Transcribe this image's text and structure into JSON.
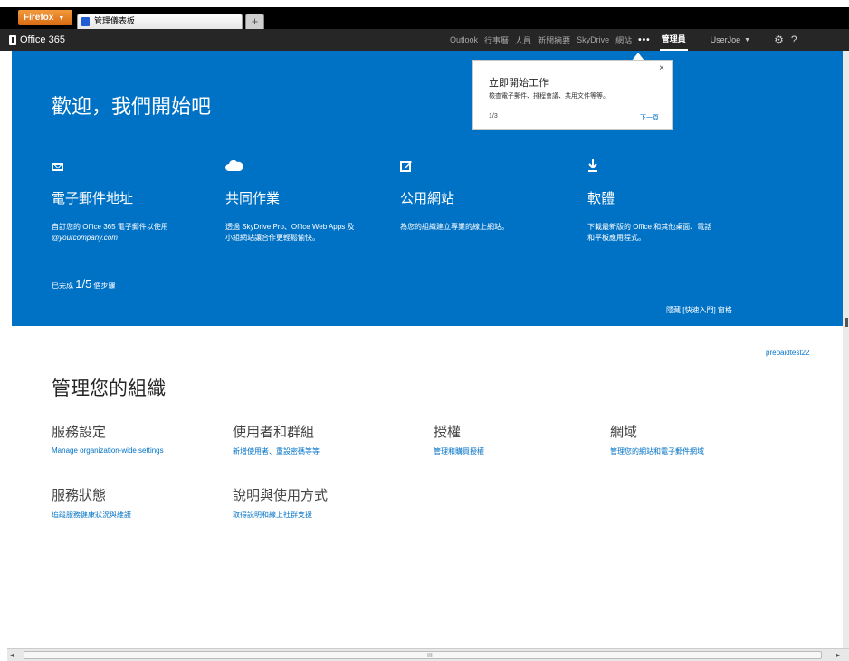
{
  "browser": {
    "menu_button": "Firefox",
    "tab_title": "管理儀表板",
    "new_tab": "+"
  },
  "navbar": {
    "brand": "Office 365",
    "links": [
      "Outlook",
      "行事曆",
      "人員",
      "新聞摘要",
      "SkyDrive",
      "網站"
    ],
    "more": "•••",
    "active": "管理員",
    "user": "UserJoe",
    "gear_icon": "gear-icon",
    "help": "?"
  },
  "hero": {
    "title": "歡迎，我們開始吧",
    "background": "#0072c6",
    "tiles": [
      {
        "icon": "mail-icon",
        "title": "電子郵件地址",
        "desc_line1": "自訂您的 Office 365 電子郵件以使用",
        "desc_line2": "@yourcompany.com"
      },
      {
        "icon": "cloud-icon",
        "title": "共同作業",
        "desc_line1": "透過 SkyDrive Pro、Office Web Apps 及",
        "desc_line2": "小組網站讓合作更輕鬆愉快。"
      },
      {
        "icon": "edit-icon",
        "title": "公用網站",
        "desc_line1": "為您的組織建立專業的線上網站。",
        "desc_line2": ""
      },
      {
        "icon": "download-icon",
        "title": "軟體",
        "desc_line1": "下載最新版的 Office 和其他桌面、電話",
        "desc_line2": "和平板應用程式。"
      }
    ],
    "progress_prefix": "已完成",
    "progress_value": "1/5",
    "progress_suffix": "個步驟",
    "hide_link": "隱藏 [快速入門] 窗格"
  },
  "callout": {
    "title": "立即開始工作",
    "desc": "檢查電子郵件、排程會議、共用文件等等。",
    "step": "1/3",
    "next": "下一頁",
    "close": "×"
  },
  "admin": {
    "tenant": "prepaidtest22",
    "title": "管理您的組織",
    "items": [
      {
        "title": "服務設定",
        "link": "Manage organization-wide settings"
      },
      {
        "title": "使用者和群組",
        "link": "新增使用者、重設密碼等等"
      },
      {
        "title": "授權",
        "link": "管理和購買授權"
      },
      {
        "title": "網域",
        "link": "管理您的網站和電子郵件網域"
      },
      {
        "title": "服務狀態",
        "link": "追蹤服務健康狀況與維護"
      },
      {
        "title": "說明與使用方式",
        "link": "取得說明和線上社群支援"
      }
    ]
  },
  "scrollbar": {
    "left": "◂",
    "right": "▸",
    "grip": "III"
  }
}
